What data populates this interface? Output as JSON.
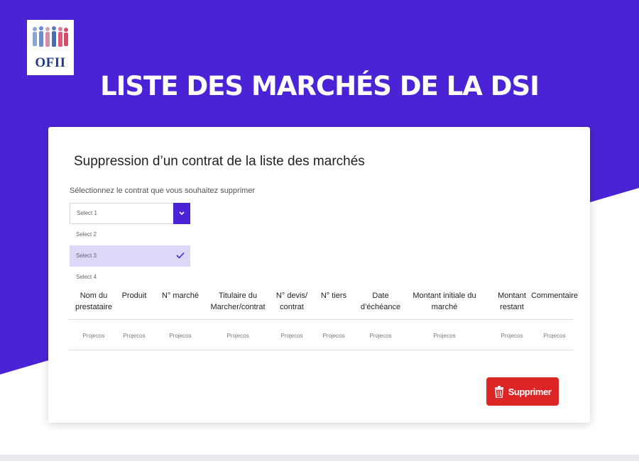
{
  "header": {
    "logo_text": "OFII",
    "title": "LISTE DES MARCHÉS DE LA DSI"
  },
  "card": {
    "title": "Suppression d’un contrat de la liste des marchés",
    "select_label": "Sélectionnez le contrat que vous souhaitez supprimer",
    "select_value": "Select 1",
    "options": [
      "Select 2",
      "Select 3",
      "Select 4"
    ],
    "selected_option": "Select 3"
  },
  "table": {
    "headers": [
      "Nom du prestataire",
      "Produit",
      "N° marché",
      "Titulaire du Marcher/contrat",
      "N° devis/ contrat",
      "N° tiers",
      "Date d’échéance",
      "Montant initiale du marché",
      "Montant restant",
      "Commentaire"
    ],
    "row": [
      "Projecos",
      "Projecos",
      "Projecos",
      "Projecos",
      "Projecos",
      "Projecos",
      "Projecos",
      "Projecos",
      "Projecos",
      "Projecos"
    ]
  },
  "actions": {
    "delete_label": "Supprimer"
  },
  "colors": {
    "brand_purple": "#4b23d6",
    "danger_red": "#dc2626",
    "selected_option_bg": "#ddd7f8"
  },
  "icons": {
    "select_arrow": "chevron-down-icon",
    "selected_check": "check-icon",
    "delete": "trash-icon"
  }
}
